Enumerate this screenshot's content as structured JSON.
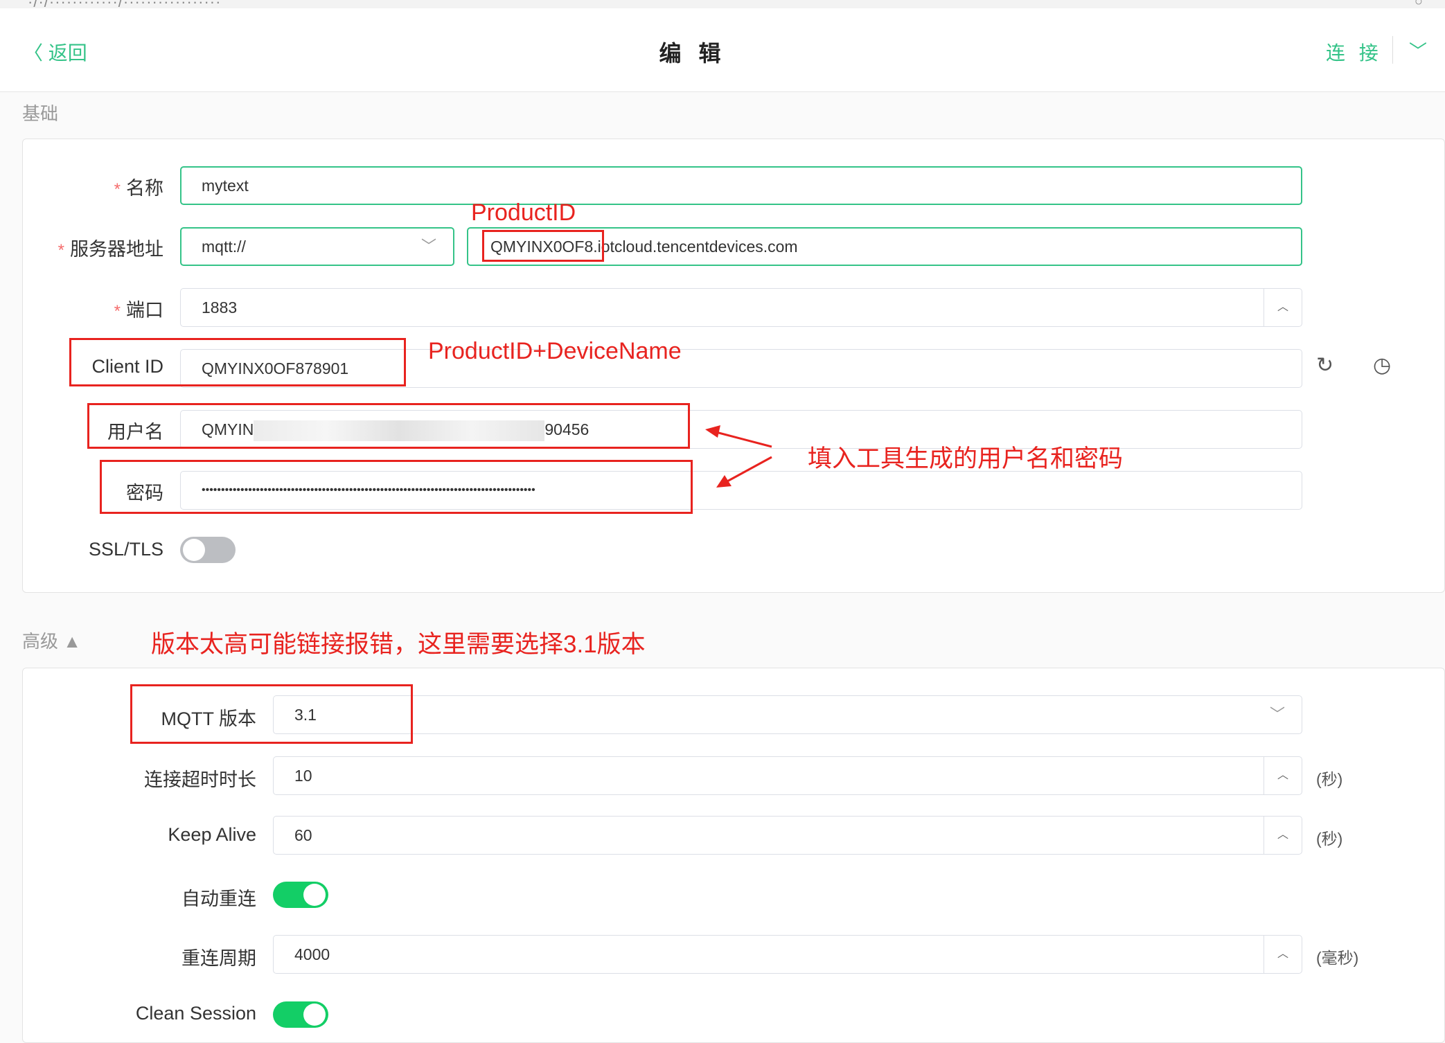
{
  "header": {
    "back_label": "〈 返回",
    "title": "编 辑",
    "connect_label": "连 接"
  },
  "basic": {
    "section_title": "基础",
    "name": {
      "label": "名称",
      "value": "mytext"
    },
    "server": {
      "label": "服务器地址",
      "protocol": "mqtt://",
      "host": "QMYINX0OF8.iotcloud.tencentdevices.com"
    },
    "port": {
      "label": "端口",
      "value": "1883"
    },
    "client_id": {
      "label": "Client ID",
      "value": "QMYINX0OF878901"
    },
    "username": {
      "label": "用户名",
      "value_start": "QMYIN",
      "value_end": "90456"
    },
    "password": {
      "label": "密码",
      "value": "••••••••••••••••••••••••••••••••••••••••••••••••••••••••••••••••••••••••••••••••••••••"
    },
    "ssl": {
      "label": "SSL/TLS",
      "on": false
    }
  },
  "advanced": {
    "section_title": "高级 ▲",
    "mqtt_version": {
      "label": "MQTT 版本",
      "value": "3.1"
    },
    "connect_timeout": {
      "label": "连接超时时长",
      "value": "10",
      "unit": "(秒)"
    },
    "keep_alive": {
      "label": "Keep Alive",
      "value": "60",
      "unit": "(秒)"
    },
    "auto_reconnect": {
      "label": "自动重连",
      "on": true
    },
    "reconnect_period": {
      "label": "重连周期",
      "value": "4000",
      "unit": "(毫秒)"
    },
    "clean_session": {
      "label": "Clean Session",
      "on": true
    }
  },
  "annotations": {
    "product_id": "ProductID",
    "client_id_hint": "ProductID+DeviceName",
    "credentials_hint": "填入工具生成的用户名和密码",
    "version_hint": "版本太高可能链接报错，这里需要选择3.1版本"
  },
  "colors": {
    "accent": "#34c388",
    "annotation_red": "#e8231f",
    "toggle_on": "#13ce66",
    "toggle_off": "#bcbec2"
  }
}
